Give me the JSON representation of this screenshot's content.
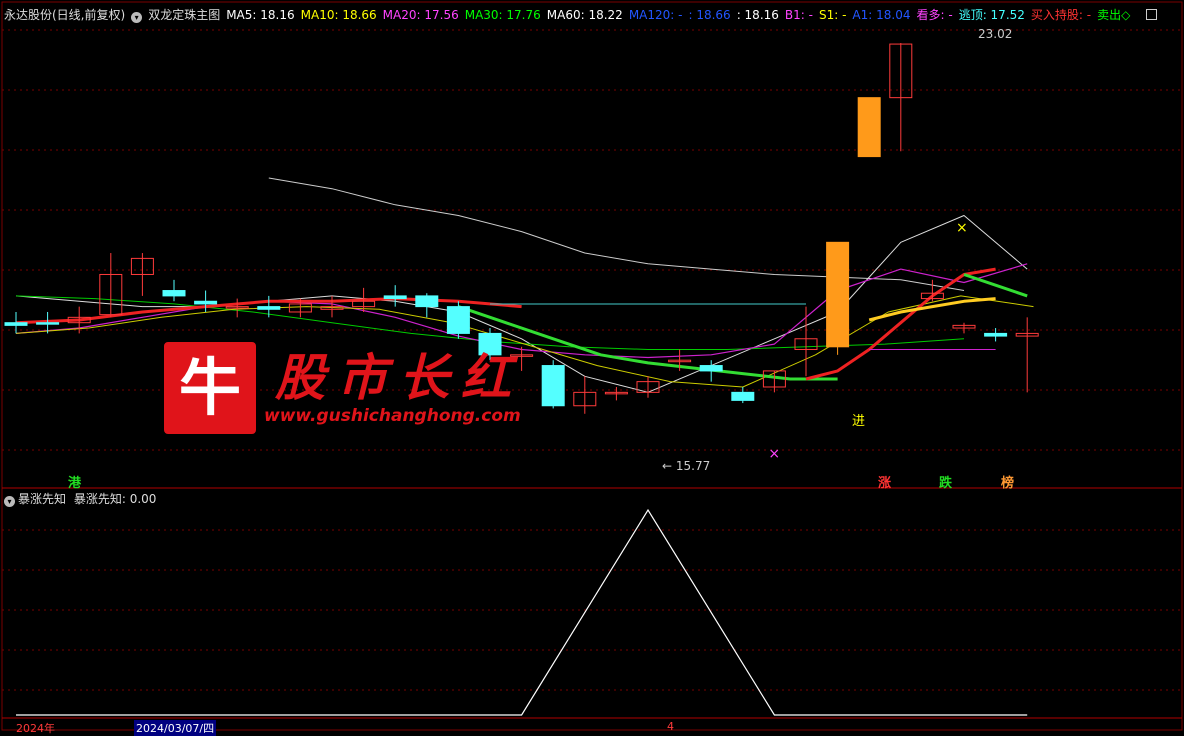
{
  "header": {
    "stock": "永达股份(日线,前复权)",
    "indicator": "双龙定珠主图",
    "items": [
      {
        "label": "MA5: 18.16",
        "color": "#ffffff"
      },
      {
        "label": "MA10: 18.66",
        "color": "#ffff00"
      },
      {
        "label": "MA20: 17.56",
        "color": "#ff44ff"
      },
      {
        "label": "MA30: 17.76",
        "color": "#00ff00"
      },
      {
        "label": "MA60: 18.22",
        "color": "#ffffff"
      },
      {
        "label": "MA120: -",
        "color": "#2255ff"
      },
      {
        "label": ": 18.66",
        "color": "#2255ff"
      },
      {
        "label": ": 18.16",
        "color": "#ffffff"
      },
      {
        "label": "B1: -",
        "color": "#ff44ff"
      },
      {
        "label": "S1: -",
        "color": "#ffff00"
      },
      {
        "label": "A1: 18.04",
        "color": "#2255ff"
      },
      {
        "label": "看多: -",
        "color": "#ff44ff"
      },
      {
        "label": "逃顶: 17.52",
        "color": "#44ffff"
      },
      {
        "label": "买入持股: -",
        "color": "#ff3333"
      },
      {
        "label": "卖出◇",
        "color": "#00ff00"
      }
    ]
  },
  "sub_header": {
    "name": "暴涨先知",
    "value_label": "暴涨先知: 0.00"
  },
  "watermark": {
    "icon_char": "牛",
    "title": "股市长红",
    "url": "www.gushichanghong.com"
  },
  "tags": {
    "gang": "港",
    "zhang": "涨",
    "die": "跌",
    "bang": "榜",
    "jin": "进"
  },
  "bottom": {
    "year": "2024年",
    "date": "2024/03/07/四",
    "marker": "4"
  },
  "colors": {
    "up": "#ff3b3b",
    "down": "#54ffff",
    "grid": "#7a0000"
  },
  "chart_data": {
    "type": "candlestick",
    "title": "",
    "ylim": [
      15.2,
      23.3
    ],
    "annotations": [
      {
        "text": "23.02",
        "index": 30
      },
      {
        "text": "15.77",
        "index": 20
      }
    ],
    "candles": [
      {
        "o": 17.8,
        "c": 17.75,
        "h": 18.0,
        "l": 17.6
      },
      {
        "o": 17.8,
        "c": 17.78,
        "h": 18.0,
        "l": 17.6
      },
      {
        "o": 17.8,
        "c": 17.9,
        "h": 18.1,
        "l": 17.6
      },
      {
        "o": 17.95,
        "c": 18.7,
        "h": 19.1,
        "l": 17.9
      },
      {
        "o": 18.7,
        "c": 19.0,
        "h": 19.1,
        "l": 18.3
      },
      {
        "o": 18.4,
        "c": 18.3,
        "h": 18.6,
        "l": 18.2
      },
      {
        "o": 18.2,
        "c": 18.15,
        "h": 18.4,
        "l": 18.0
      },
      {
        "o": 18.1,
        "c": 18.1,
        "h": 18.25,
        "l": 17.9
      },
      {
        "o": 18.1,
        "c": 18.05,
        "h": 18.3,
        "l": 17.9
      },
      {
        "o": 18.0,
        "c": 18.15,
        "h": 18.25,
        "l": 17.9
      },
      {
        "o": 18.05,
        "c": 18.1,
        "h": 18.3,
        "l": 17.9
      },
      {
        "o": 18.1,
        "c": 18.2,
        "h": 18.45,
        "l": 18.0
      },
      {
        "o": 18.3,
        "c": 18.25,
        "h": 18.5,
        "l": 18.1
      },
      {
        "o": 18.3,
        "c": 18.1,
        "h": 18.35,
        "l": 17.9
      },
      {
        "o": 18.1,
        "c": 17.6,
        "h": 18.2,
        "l": 17.5
      },
      {
        "o": 17.6,
        "c": 17.2,
        "h": 17.7,
        "l": 17.1
      },
      {
        "o": 17.2,
        "c": 17.2,
        "h": 17.35,
        "l": 16.9
      },
      {
        "o": 17.0,
        "c": 16.25,
        "h": 17.1,
        "l": 16.2
      },
      {
        "o": 16.25,
        "c": 16.5,
        "h": 16.8,
        "l": 16.1
      },
      {
        "o": 16.5,
        "c": 16.5,
        "h": 16.6,
        "l": 16.35
      },
      {
        "o": 16.5,
        "c": 16.7,
        "h": 16.8,
        "l": 16.4
      },
      {
        "o": 17.1,
        "c": 17.1,
        "h": 17.3,
        "l": 16.9
      },
      {
        "o": 17.0,
        "c": 16.9,
        "h": 17.1,
        "l": 16.7
      },
      {
        "o": 16.5,
        "c": 16.35,
        "h": 16.6,
        "l": 16.3
      },
      {
        "o": 16.6,
        "c": 16.9,
        "h": 16.9,
        "l": 16.5
      },
      {
        "o": 17.3,
        "c": 17.5,
        "h": 18.1,
        "l": 16.8
      },
      {
        "o": 17.35,
        "c": 19.3,
        "h": 19.3,
        "l": 17.2
      },
      {
        "o": 20.9,
        "c": 22.0,
        "h": 22.0,
        "l": 20.9
      },
      {
        "o": 22.0,
        "c": 23.0,
        "h": 23.02,
        "l": 21.0
      },
      {
        "o": 18.25,
        "c": 18.35,
        "h": 18.6,
        "l": 18.2
      },
      {
        "o": 17.7,
        "c": 17.75,
        "h": 17.8,
        "l": 17.6
      },
      {
        "o": 17.6,
        "c": 17.55,
        "h": 17.7,
        "l": 17.45
      },
      {
        "o": 17.55,
        "c": 17.6,
        "h": 17.9,
        "l": 16.5
      }
    ],
    "ma_white": [
      18.3,
      18.2,
      18.1,
      18.1,
      18.2,
      18.3,
      18.2,
      18.0,
      17.5,
      16.8,
      16.5,
      17.0,
      17.5,
      18.0,
      19.3,
      19.8,
      18.8
    ],
    "ma60": [
      20.5,
      20.3,
      20.0,
      19.8,
      19.5,
      19.1,
      18.9,
      18.8,
      18.7,
      18.65,
      18.6,
      18.4
    ],
    "sub_chart": {
      "values": [
        0,
        0,
        0,
        0,
        0,
        1,
        0,
        0,
        0
      ],
      "ylim": [
        0,
        1
      ]
    }
  }
}
